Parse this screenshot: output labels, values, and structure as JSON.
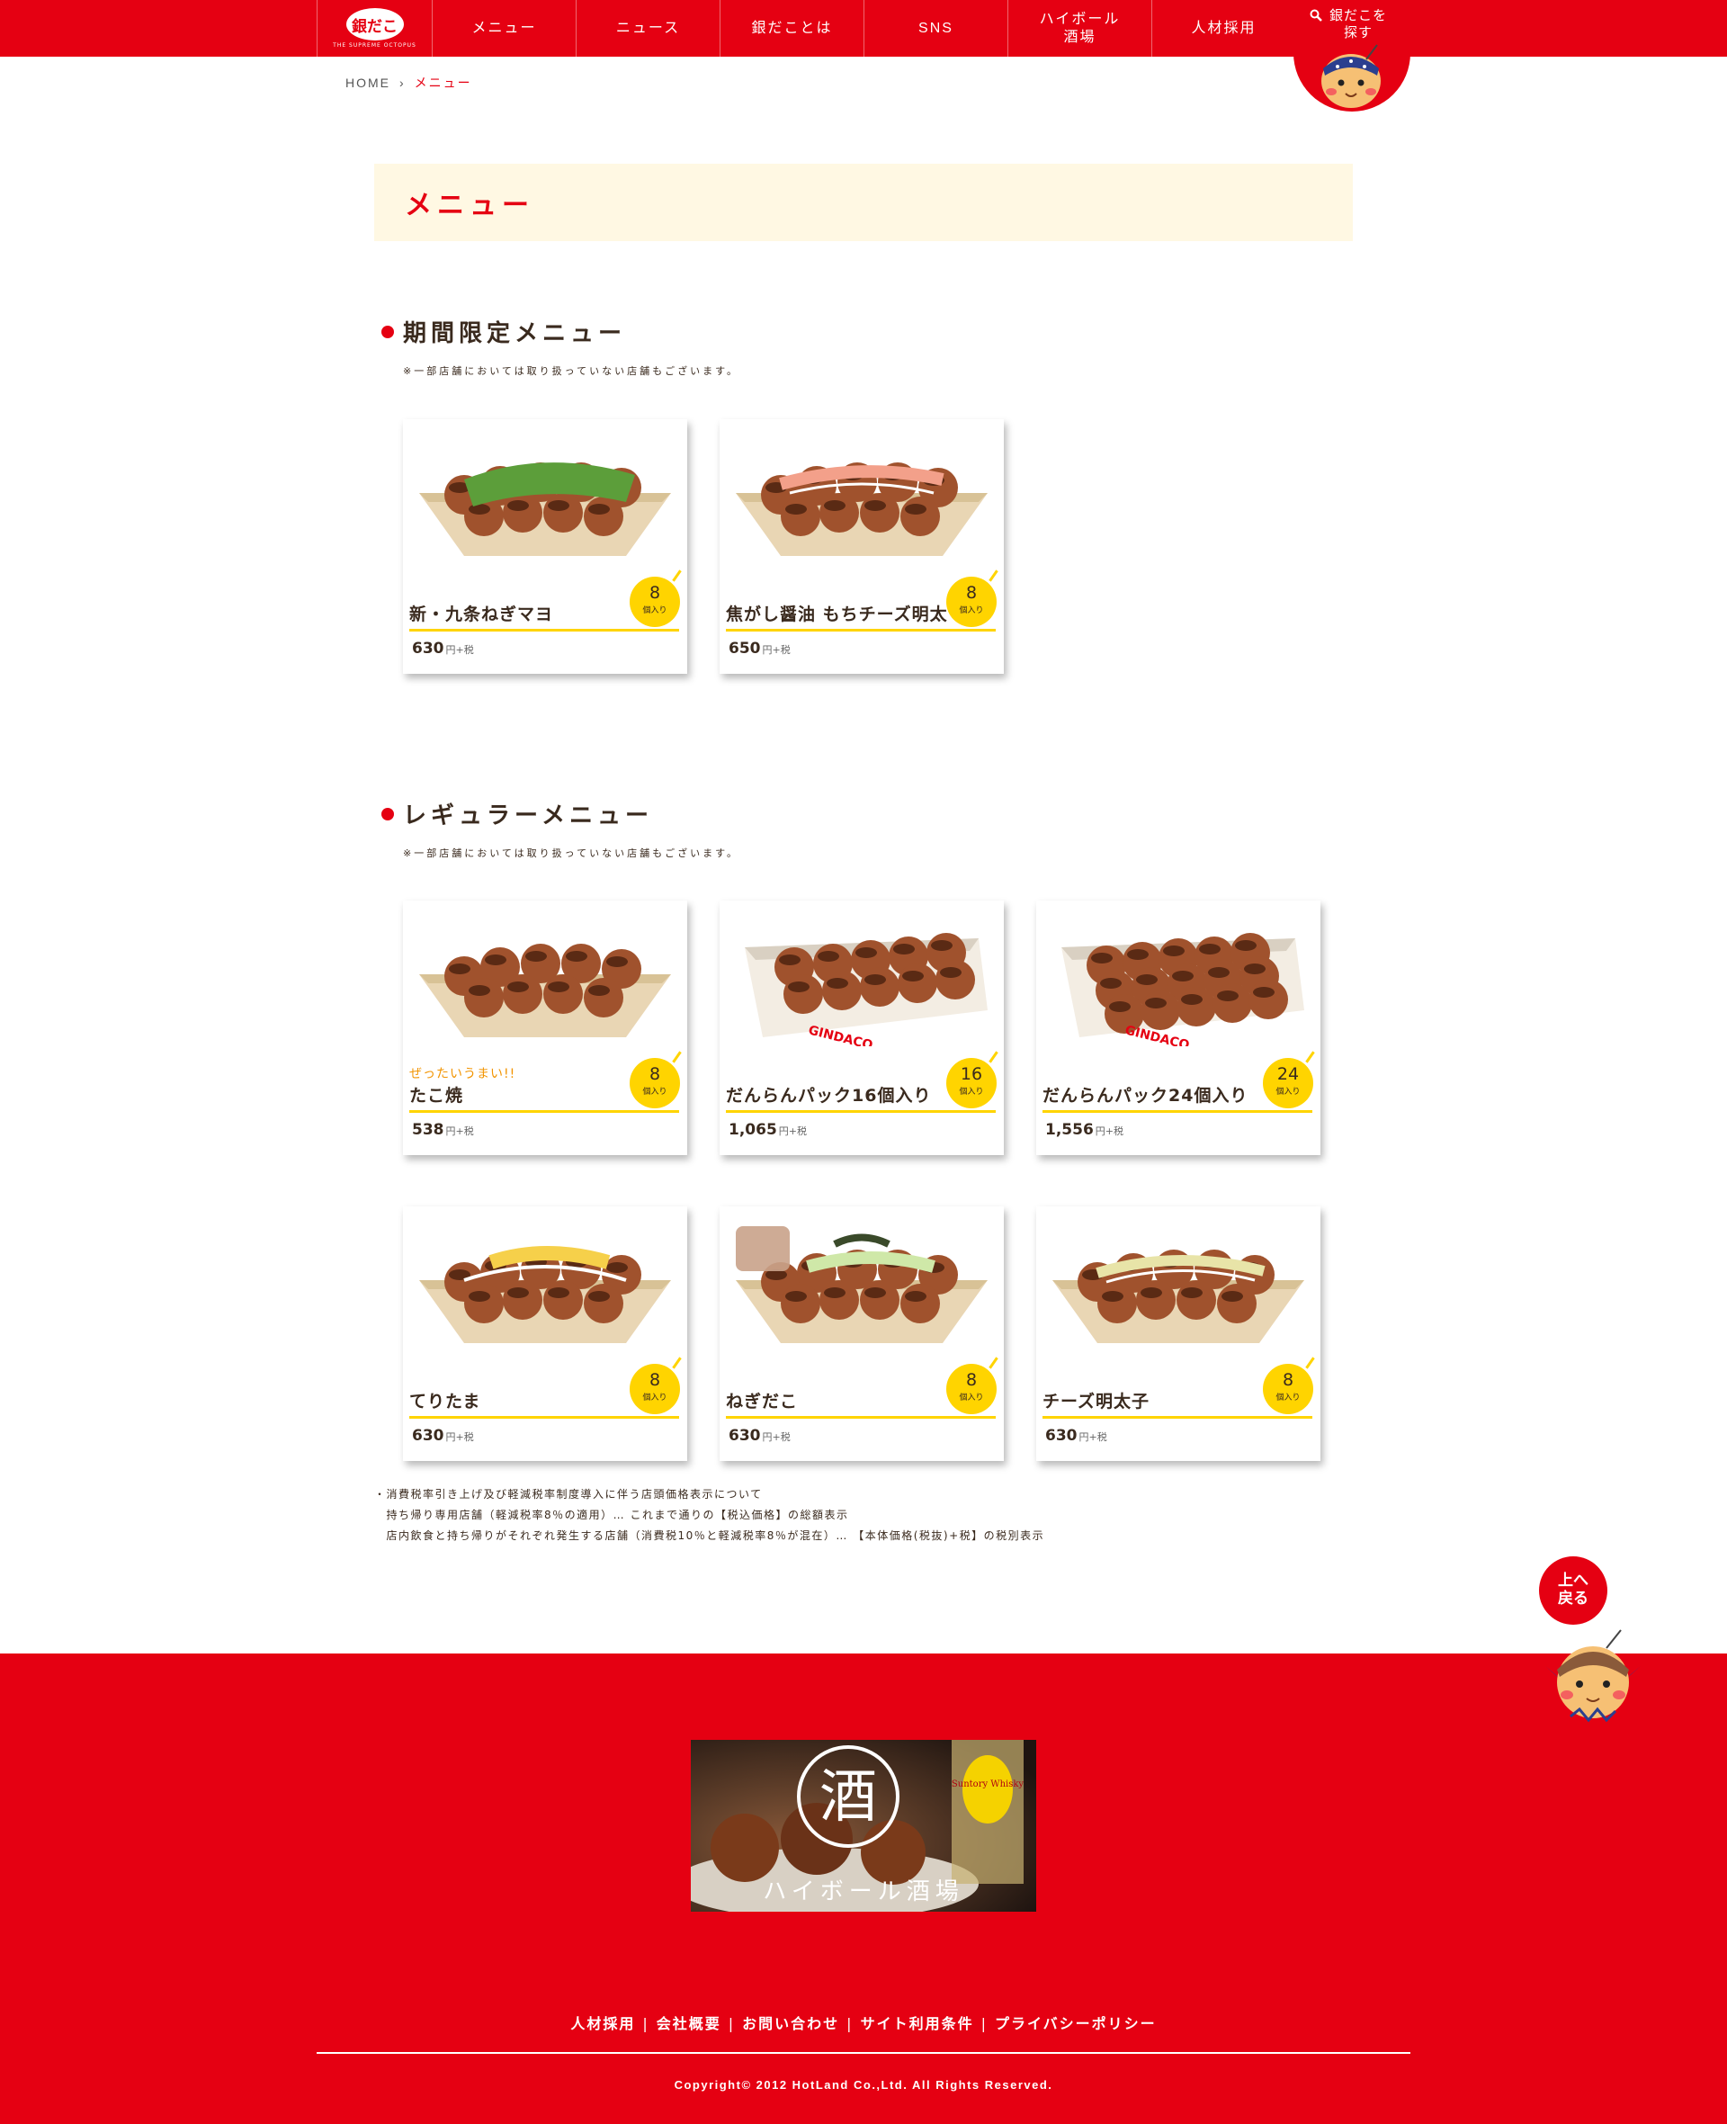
{
  "header": {
    "logo_text": "銀だこ",
    "logo_tagline": "THE SUPREME OCTOPUS",
    "nav": [
      "メニュー",
      "ニュース",
      "銀だことは",
      "SNS",
      "ハイボール\n酒場",
      "人材採用"
    ],
    "find_label": "銀だこを\n探す"
  },
  "breadcrumb": {
    "home": "HOME",
    "sep": "›",
    "current": "メニュー"
  },
  "page_title": "メニュー",
  "limited": {
    "heading": "期間限定メニュー",
    "note": "※一部店舗においては取り扱っていない店舗もございます。",
    "items": [
      {
        "name": "新・九条ねぎマヨ",
        "price": "630",
        "unit": "円+税",
        "count": "8",
        "count_unit": "個入り",
        "catch": "",
        "food_icon": "takoyaki-negi-icon"
      },
      {
        "name": "焦がし醤油 もちチーズ明太",
        "price": "650",
        "unit": "円+税",
        "count": "8",
        "count_unit": "個入り",
        "catch": "",
        "food_icon": "takoyaki-mentai-icon"
      }
    ]
  },
  "regular": {
    "heading": "レギュラーメニュー",
    "note": "※一部店舗においては取り扱っていない店舗もございます。",
    "items": [
      {
        "name": "たこ焼",
        "price": "538",
        "unit": "円+税",
        "count": "8",
        "count_unit": "個入り",
        "catch": "ぜったいうまい!!",
        "food_icon": "takoyaki-boat-icon"
      },
      {
        "name": "だんらんパック16個入り",
        "price": "1,065",
        "unit": "円+税",
        "count": "16",
        "count_unit": "個入り",
        "catch": "",
        "food_icon": "takoyaki-box16-icon"
      },
      {
        "name": "だんらんパック24個入り",
        "price": "1,556",
        "unit": "円+税",
        "count": "24",
        "count_unit": "個入り",
        "catch": "",
        "food_icon": "takoyaki-box24-icon"
      },
      {
        "name": "てりたま",
        "price": "630",
        "unit": "円+税",
        "count": "8",
        "count_unit": "個入り",
        "catch": "",
        "food_icon": "takoyaki-teritama-icon"
      },
      {
        "name": "ねぎだこ",
        "price": "630",
        "unit": "円+税",
        "count": "8",
        "count_unit": "個入り",
        "catch": "",
        "food_icon": "takoyaki-negidako-icon"
      },
      {
        "name": "チーズ明太子",
        "price": "630",
        "unit": "円+税",
        "count": "8",
        "count_unit": "個入り",
        "catch": "",
        "food_icon": "takoyaki-cheese-icon"
      }
    ]
  },
  "tax_note": [
    "・消費税率引き上げ及び軽減税率制度導入に伴う店頭価格表示について",
    "　持ち帰り専用店舗（軽減税率8％の適用）… これまで通りの【税込価格】の総額表示",
    "　店内飲食と持ち帰りがそれぞれ発生する店舗（消費税10％と軽減税率8％が混在）… 【本体価格(税抜)+税】の税別表示"
  ],
  "to_top": "上へ\n戻る",
  "footer": {
    "banner_text": "ハイボール酒場",
    "banner_kanji": "酒",
    "bottle_label": "Suntory Whisky",
    "links": [
      "人材採用",
      "会社概要",
      "お問い合わせ",
      "サイト利用条件",
      "プライバシーポリシー"
    ],
    "copyright": "Copyright© 2012 HotLand Co.,Ltd. All Rights Reserved."
  },
  "colors": {
    "brand_red": "#e50012",
    "yellow": "#ffd400",
    "cream": "#fff8e3",
    "brown": "#3a2a1e"
  }
}
